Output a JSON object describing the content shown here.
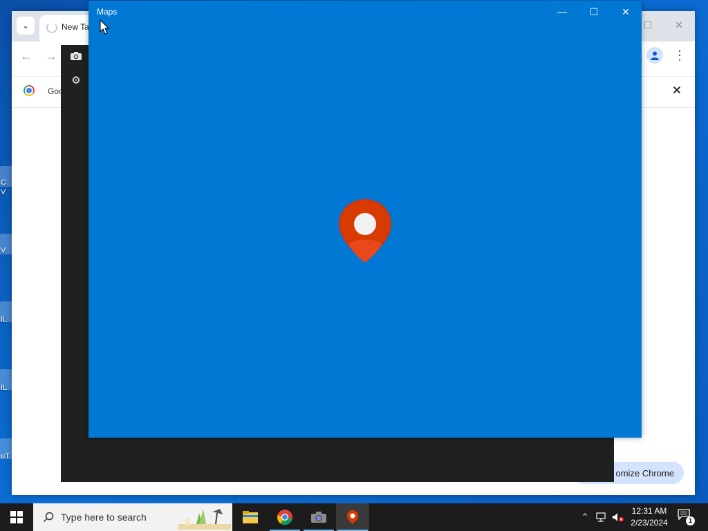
{
  "desktop": {
    "icons": [
      {
        "label": "C",
        "label2": "V"
      },
      {
        "label": "V"
      },
      {
        "label": "IL"
      },
      {
        "label": "IL"
      },
      {
        "label": "uT"
      }
    ]
  },
  "chrome": {
    "tab_search_icon": "chevron-down-icon",
    "tab_title": "New Ta",
    "infobar_text": "Goo",
    "customize_label": "omize Chrome",
    "profile_icon": "person-icon",
    "menu_icon": "kebab-icon"
  },
  "camera": {
    "icons": [
      "camera-icon",
      "gear-icon"
    ]
  },
  "maps": {
    "title": "Maps",
    "accent": "#0078d4",
    "pin_color": "#d83b01"
  },
  "taskbar": {
    "search_placeholder": "Type here to search",
    "apps": [
      "file-explorer-icon",
      "chrome-icon",
      "camera-icon",
      "maps-icon"
    ],
    "active_app": "maps-icon",
    "clock_time": "12:31 AM",
    "clock_date": "2/23/2024",
    "notification_count": "1"
  }
}
